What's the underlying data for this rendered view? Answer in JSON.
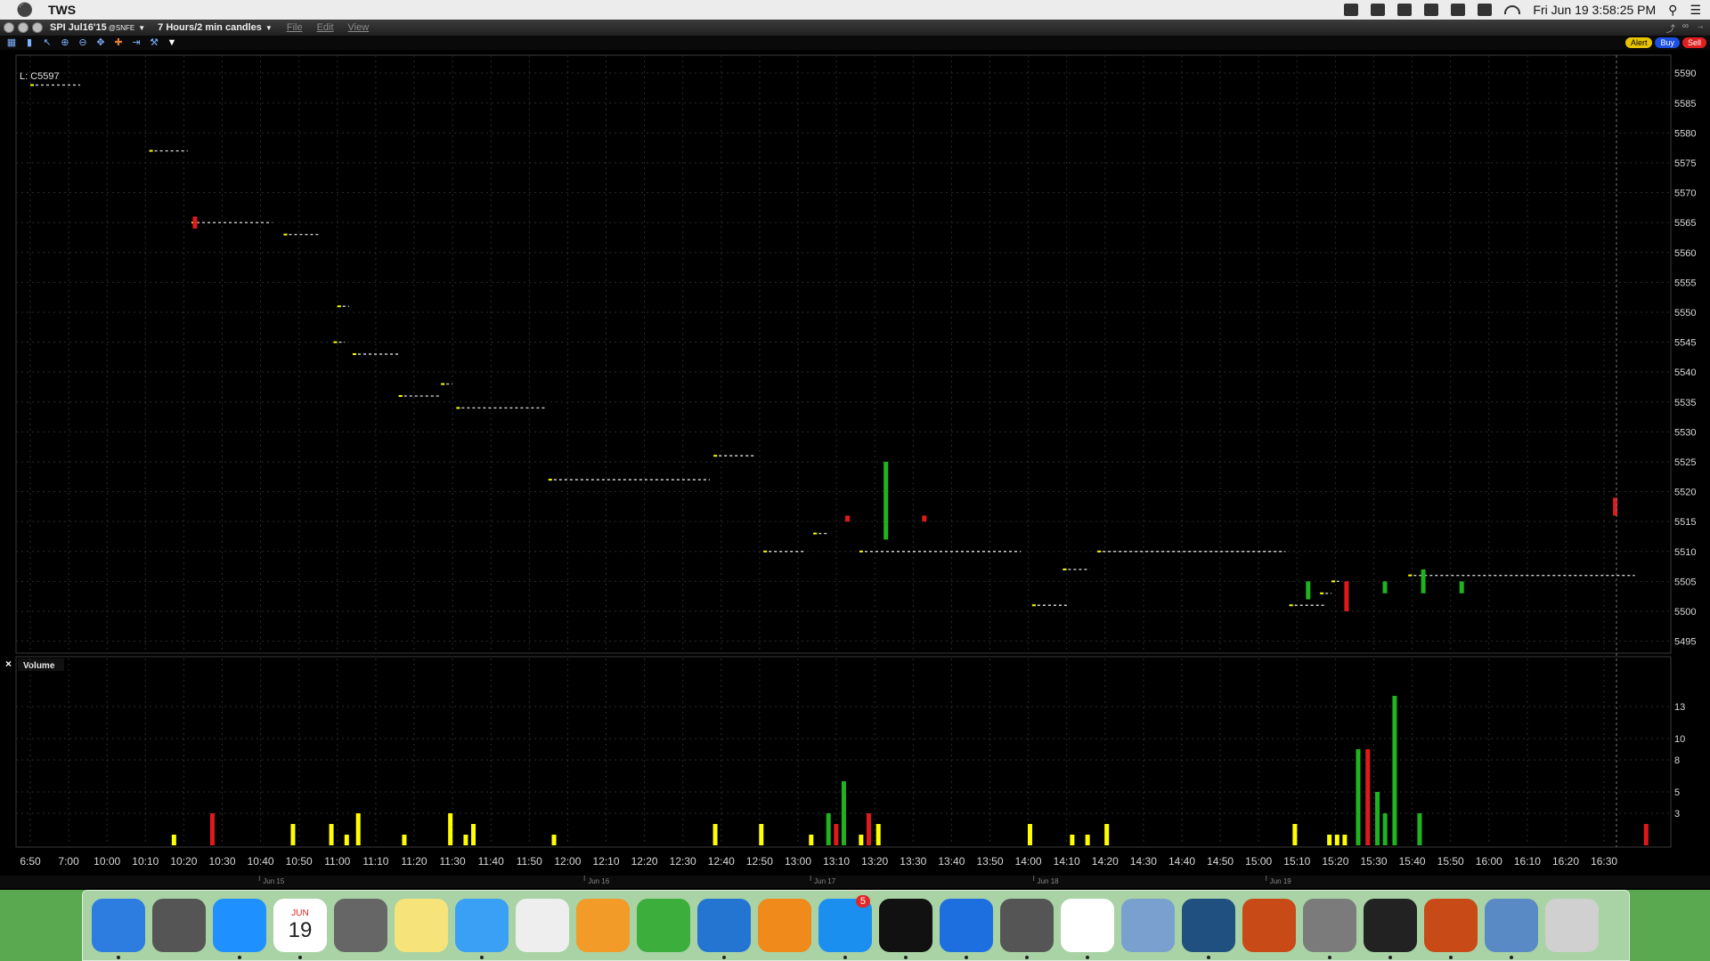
{
  "menubar": {
    "app_name": "TWS",
    "clock": "Fri Jun 19  3:58:25 PM"
  },
  "window": {
    "symbol": "SPI Jul16'15",
    "exchange": "@SNFE",
    "period": "7 Hours/2 min candles",
    "menus": [
      "File",
      "Edit",
      "View"
    ],
    "order_buttons": {
      "alert": "Alert",
      "buy": "Buy",
      "sell": "Sell"
    }
  },
  "colors": {
    "up": "#1fb31f",
    "down": "#e01a1a",
    "neutral": "#ffff00",
    "grid": "#2b2b2b",
    "axis_text": "#d8d8d8"
  },
  "chart_data": {
    "type": "candlestick",
    "last_label": "L: C5597",
    "price_ylim": [
      5493,
      5593
    ],
    "price_ticks": [
      5590,
      5585,
      5580,
      5575,
      5570,
      5565,
      5560,
      5555,
      5550,
      5545,
      5540,
      5535,
      5530,
      5525,
      5520,
      5515,
      5510,
      5505,
      5500,
      5495
    ],
    "volume_title": "Volume",
    "volume_ylim": [
      0,
      16
    ],
    "volume_ticks": [
      "13",
      "10",
      "8",
      "5",
      "3"
    ],
    "time_labels": [
      "6:50",
      "7:00",
      "10:00",
      "10:10",
      "10:20",
      "10:30",
      "10:40",
      "10:50",
      "11:00",
      "11:10",
      "11:20",
      "11:30",
      "11:40",
      "11:50",
      "12:00",
      "12:10",
      "12:20",
      "12:30",
      "12:40",
      "12:50",
      "13:00",
      "13:10",
      "13:20",
      "13:30",
      "13:40",
      "13:50",
      "14:00",
      "14:10",
      "14:20",
      "14:30",
      "14:40",
      "14:50",
      "15:00",
      "15:10",
      "15:20",
      "15:30",
      "15:40",
      "15:50",
      "16:00",
      "16:10",
      "16:20",
      "16:30"
    ],
    "date_labels": [
      "Jun 15",
      "Jun 16",
      "Jun 17",
      "Jun 18",
      "Jun 19"
    ],
    "candles": [
      {
        "i": 4,
        "o": 5566,
        "c": 5564,
        "color": "down"
      },
      {
        "i": 21,
        "o": 5515,
        "c": 5516,
        "color": "down"
      },
      {
        "i": 22,
        "o": 5512,
        "c": 5525,
        "color": "up"
      },
      {
        "i": 23,
        "o": 5515,
        "c": 5516,
        "color": "down"
      },
      {
        "i": 33,
        "o": 5502,
        "c": 5505,
        "color": "up"
      },
      {
        "i": 34,
        "o": 5505,
        "c": 5500,
        "color": "down"
      },
      {
        "i": 35,
        "o": 5503,
        "c": 5505,
        "color": "up"
      },
      {
        "i": 36,
        "o": 5503,
        "c": 5507,
        "color": "up"
      },
      {
        "i": 37,
        "o": 5505,
        "c": 5503,
        "color": "up"
      },
      {
        "i": 41,
        "o": 5519,
        "c": 5516,
        "color": "down"
      }
    ],
    "levels": [
      {
        "from": 0,
        "to": 1.3,
        "price": 5588
      },
      {
        "from": 3.1,
        "to": 4.1,
        "price": 5577
      },
      {
        "from": 4.2,
        "to": 6.3,
        "price": 5565
      },
      {
        "from": 6.6,
        "to": 7.5,
        "price": 5563
      },
      {
        "from": 8,
        "to": 8.3,
        "price": 5551
      },
      {
        "from": 7.9,
        "to": 8.2,
        "price": 5545
      },
      {
        "from": 8.4,
        "to": 9.6,
        "price": 5543
      },
      {
        "from": 9.6,
        "to": 10.7,
        "price": 5536
      },
      {
        "from": 10.7,
        "to": 11,
        "price": 5538
      },
      {
        "from": 11.1,
        "to": 13.4,
        "price": 5534
      },
      {
        "from": 13.5,
        "to": 17.7,
        "price": 5522
      },
      {
        "from": 17.8,
        "to": 18.9,
        "price": 5526
      },
      {
        "from": 19.1,
        "to": 20.2,
        "price": 5510
      },
      {
        "from": 20.4,
        "to": 20.8,
        "price": 5513
      },
      {
        "from": 21.6,
        "to": 25.8,
        "price": 5510
      },
      {
        "from": 26.1,
        "to": 27,
        "price": 5501
      },
      {
        "from": 26.9,
        "to": 27.6,
        "price": 5507
      },
      {
        "from": 27.8,
        "to": 32.7,
        "price": 5510
      },
      {
        "from": 32.8,
        "to": 33.7,
        "price": 5501
      },
      {
        "from": 33.6,
        "to": 33.9,
        "price": 5503
      },
      {
        "from": 33.9,
        "to": 34.1,
        "price": 5505
      },
      {
        "from": 35.9,
        "to": 41.8,
        "price": 5506
      }
    ],
    "volume": [
      {
        "x": 3.5,
        "v": 1,
        "c": "neutral"
      },
      {
        "x": 4.5,
        "v": 3,
        "c": "down"
      },
      {
        "x": 6.6,
        "v": 2,
        "c": "neutral"
      },
      {
        "x": 7.6,
        "v": 2,
        "c": "neutral"
      },
      {
        "x": 8,
        "v": 1,
        "c": "neutral"
      },
      {
        "x": 8.3,
        "v": 3,
        "c": "neutral"
      },
      {
        "x": 9.5,
        "v": 1,
        "c": "neutral"
      },
      {
        "x": 10.7,
        "v": 3,
        "c": "neutral"
      },
      {
        "x": 11.1,
        "v": 1,
        "c": "neutral"
      },
      {
        "x": 11.3,
        "v": 2,
        "c": "neutral"
      },
      {
        "x": 13.4,
        "v": 1,
        "c": "neutral"
      },
      {
        "x": 17.6,
        "v": 2,
        "c": "neutral"
      },
      {
        "x": 18.8,
        "v": 2,
        "c": "neutral"
      },
      {
        "x": 20.1,
        "v": 1,
        "c": "neutral"
      },
      {
        "x": 20.55,
        "v": 3,
        "c": "up"
      },
      {
        "x": 20.75,
        "v": 2,
        "c": "down"
      },
      {
        "x": 20.95,
        "v": 6,
        "c": "up"
      },
      {
        "x": 21.4,
        "v": 1,
        "c": "neutral"
      },
      {
        "x": 21.6,
        "v": 3,
        "c": "down"
      },
      {
        "x": 21.85,
        "v": 2,
        "c": "neutral"
      },
      {
        "x": 25.8,
        "v": 2,
        "c": "neutral"
      },
      {
        "x": 26.9,
        "v": 1,
        "c": "neutral"
      },
      {
        "x": 27.3,
        "v": 1,
        "c": "neutral"
      },
      {
        "x": 27.8,
        "v": 2,
        "c": "neutral"
      },
      {
        "x": 32.7,
        "v": 2,
        "c": "neutral"
      },
      {
        "x": 33.6,
        "v": 1,
        "c": "neutral"
      },
      {
        "x": 33.8,
        "v": 1,
        "c": "neutral"
      },
      {
        "x": 34,
        "v": 1,
        "c": "neutral"
      },
      {
        "x": 34.35,
        "v": 9,
        "c": "up"
      },
      {
        "x": 34.6,
        "v": 9,
        "c": "down"
      },
      {
        "x": 34.85,
        "v": 5,
        "c": "up"
      },
      {
        "x": 35.05,
        "v": 3,
        "c": "up"
      },
      {
        "x": 35.3,
        "v": 14,
        "c": "up"
      },
      {
        "x": 35.95,
        "v": 3,
        "c": "up"
      },
      {
        "x": 41.85,
        "v": 2,
        "c": "down"
      }
    ]
  },
  "dock": {
    "items": [
      {
        "name": "finder-icon",
        "color": "#2d7de0",
        "running": true
      },
      {
        "name": "launchpad-icon",
        "color": "#555",
        "running": false
      },
      {
        "name": "safari-icon",
        "color": "#1e90ff",
        "running": true
      },
      {
        "name": "calendar-icon",
        "color": "#ffffff",
        "running": true,
        "label": "19",
        "sub": "JUN"
      },
      {
        "name": "calculator-icon",
        "color": "#666",
        "running": false
      },
      {
        "name": "notes-icon",
        "color": "#f6e37a",
        "running": false
      },
      {
        "name": "messages-icon",
        "color": "#3aa0f5",
        "running": true
      },
      {
        "name": "textedit-icon",
        "color": "#eee",
        "running": false
      },
      {
        "name": "pages-icon",
        "color": "#f29b28",
        "running": false
      },
      {
        "name": "numbers-icon",
        "color": "#3cae3c",
        "running": false
      },
      {
        "name": "vmware-icon",
        "color": "#2474d2",
        "running": true
      },
      {
        "name": "ibooks-icon",
        "color": "#f08a1a",
        "running": false
      },
      {
        "name": "app-store-icon",
        "color": "#1b8ff0",
        "running": true,
        "badge": "5"
      },
      {
        "name": "terminal-icon",
        "color": "#111",
        "running": true
      },
      {
        "name": "teamviewer-icon",
        "color": "#1d6fe0",
        "running": true
      },
      {
        "name": "dvd-player-icon",
        "color": "#555",
        "running": true
      },
      {
        "name": "java-icon",
        "color": "#fff",
        "running": true
      },
      {
        "name": "network-icon",
        "color": "#7aa0d0",
        "running": false
      },
      {
        "name": "sourcetree-icon",
        "color": "#205080",
        "running": true
      },
      {
        "name": "matlab-icon",
        "color": "#c84a16",
        "running": false
      },
      {
        "name": "system-preferences-icon",
        "color": "#7b7b7b",
        "running": true
      },
      {
        "name": "activity-monitor-icon",
        "color": "#222",
        "running": true
      },
      {
        "name": "matlab-icon",
        "color": "#c84a16",
        "running": true
      },
      {
        "name": "preview-icon",
        "color": "#5a8ac6",
        "running": true
      },
      {
        "name": "trash-icon",
        "color": "#d0d0d0",
        "running": false
      }
    ]
  }
}
